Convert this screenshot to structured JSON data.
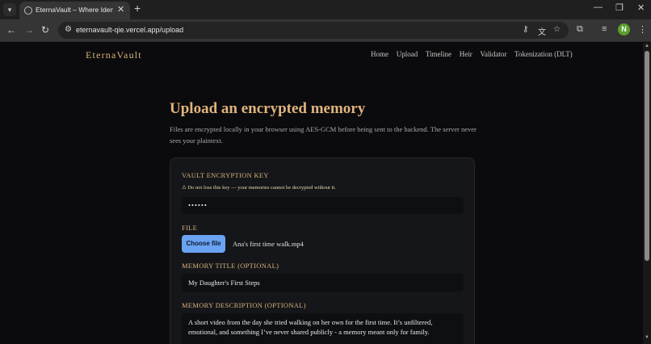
{
  "browser": {
    "tab_title": "EternaVault – Where Identity M",
    "url": "eternavault-qie.vercel.app/upload",
    "profile_initial": "N"
  },
  "site": {
    "logo": "EternaVault",
    "nav": [
      "Home",
      "Upload",
      "Timeline",
      "Heir",
      "Validator",
      "Tokenization (DLT)"
    ]
  },
  "upload": {
    "title": "Upload an encrypted memory",
    "intro": "Files are encrypted locally in your browser using AES-GCM before being sent to the backend. The server never sees your plaintext.",
    "key_label": "VAULT ENCRYPTION KEY",
    "key_warning": "⚠ Do not lose this key — your memories cannot be decrypted without it.",
    "key_value": "••••••",
    "file_label": "FILE",
    "choose_button": "Choose file",
    "file_name": "Ana's first time walk.mp4",
    "title_label": "MEMORY TITLE (OPTIONAL)",
    "title_value": "My Daughter's First Steps",
    "description_label": "MEMORY DESCRIPTION (OPTIONAL)",
    "description_value": "A short video from the day she tried walking on her own for the first time. It’s unfiltered, emotional, and something I’ve never shared publicly - a memory meant only for family."
  },
  "colors": {
    "accent_gold": "#d8b37a",
    "button_blue": "#6aa3f2",
    "background": "#0b0b0d",
    "card": "#15161a"
  }
}
